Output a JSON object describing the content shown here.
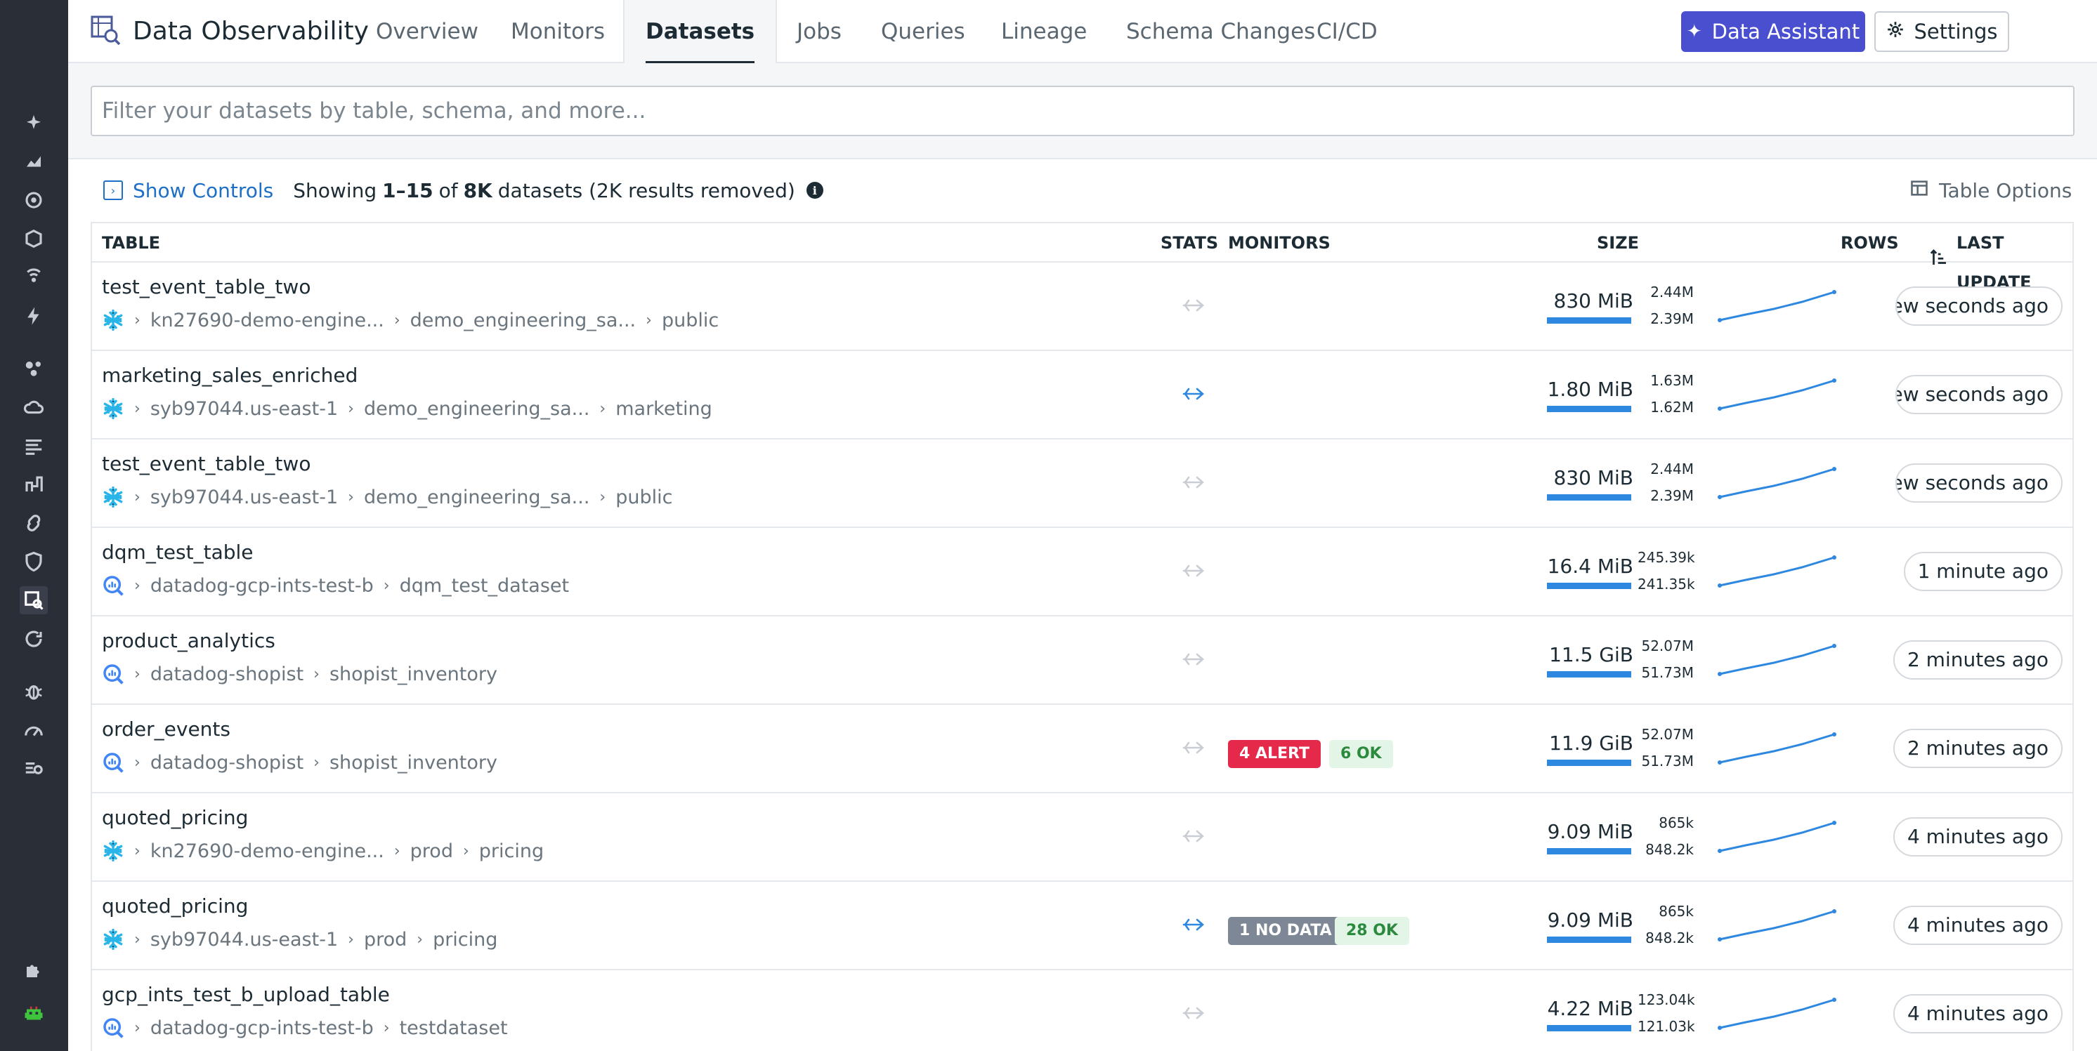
{
  "app": {
    "title": "Data Observability"
  },
  "nav": {
    "tabs": [
      {
        "label": "Overview"
      },
      {
        "label": "Monitors"
      },
      {
        "label": "Datasets"
      },
      {
        "label": "Jobs"
      },
      {
        "label": "Queries"
      },
      {
        "label": "Lineage"
      },
      {
        "label": "Schema Changes"
      },
      {
        "label": "CI/CD"
      }
    ],
    "active_tab": "Datasets",
    "assistant_label": "Data Assistant",
    "settings_label": "Settings"
  },
  "filter": {
    "placeholder": "Filter your datasets by table, schema, and more...",
    "value": ""
  },
  "controls": {
    "show_controls_label": "Show Controls",
    "summary_prefix": "Showing",
    "summary_range": "1–15",
    "summary_of": "of",
    "summary_total": "8K",
    "summary_suffix": "datasets (2K results removed)",
    "table_options_label": "Table Options"
  },
  "table": {
    "columns": {
      "table": "TABLE",
      "stats": "STATS",
      "monitors": "MONITORS",
      "size": "SIZE",
      "rows": "ROWS",
      "last_update": "LAST UPDATE"
    },
    "rows": [
      {
        "name": "test_event_table_two",
        "source": "snowflake",
        "path": [
          "kn27690-demo-engine...",
          "demo_engineering_sa...",
          "public"
        ],
        "stats": "inactive",
        "monitors": [],
        "size": "830 MiB",
        "rows_hi": "2.44M",
        "rows_lo": "2.39M",
        "last_update": "a few seconds ago"
      },
      {
        "name": "marketing_sales_enriched",
        "source": "snowflake",
        "path": [
          "syb97044.us-east-1",
          "demo_engineering_sa...",
          "marketing"
        ],
        "stats": "active",
        "monitors": [],
        "size": "1.80 MiB",
        "rows_hi": "1.63M",
        "rows_lo": "1.62M",
        "last_update": "a few seconds ago"
      },
      {
        "name": "test_event_table_two",
        "source": "snowflake",
        "path": [
          "syb97044.us-east-1",
          "demo_engineering_sa...",
          "public"
        ],
        "stats": "inactive",
        "monitors": [],
        "size": "830 MiB",
        "rows_hi": "2.44M",
        "rows_lo": "2.39M",
        "last_update": "a few seconds ago"
      },
      {
        "name": "dqm_test_table",
        "source": "bigquery",
        "path": [
          "datadog-gcp-ints-test-b",
          "dqm_test_dataset"
        ],
        "stats": "inactive",
        "monitors": [],
        "size": "16.4 MiB",
        "rows_hi": "245.39k",
        "rows_lo": "241.35k",
        "last_update": "1 minute ago"
      },
      {
        "name": "product_analytics",
        "source": "bigquery",
        "path": [
          "datadog-shopist",
          "shopist_inventory"
        ],
        "stats": "inactive",
        "monitors": [],
        "size": "11.5 GiB",
        "rows_hi": "52.07M",
        "rows_lo": "51.73M",
        "last_update": "2 minutes ago"
      },
      {
        "name": "order_events",
        "source": "bigquery",
        "path": [
          "datadog-shopist",
          "shopist_inventory"
        ],
        "stats": "inactive",
        "monitors": [
          {
            "kind": "alert",
            "label": "4 ALERT"
          },
          {
            "kind": "ok",
            "label": "6 OK"
          }
        ],
        "size": "11.9 GiB",
        "rows_hi": "52.07M",
        "rows_lo": "51.73M",
        "last_update": "2 minutes ago"
      },
      {
        "name": "quoted_pricing",
        "source": "snowflake",
        "path": [
          "kn27690-demo-engine...",
          "prod",
          "pricing"
        ],
        "stats": "inactive",
        "monitors": [],
        "size": "9.09 MiB",
        "rows_hi": "865k",
        "rows_lo": "848.2k",
        "last_update": "4 minutes ago"
      },
      {
        "name": "quoted_pricing",
        "source": "snowflake",
        "path": [
          "syb97044.us-east-1",
          "prod",
          "pricing"
        ],
        "stats": "active",
        "monitors": [
          {
            "kind": "nodata",
            "label": "1 NO DATA"
          },
          {
            "kind": "ok",
            "label": "28 OK"
          }
        ],
        "size": "9.09 MiB",
        "rows_hi": "865k",
        "rows_lo": "848.2k",
        "last_update": "4 minutes ago"
      },
      {
        "name": "gcp_ints_test_b_upload_table",
        "source": "bigquery",
        "path": [
          "datadog-gcp-ints-test-b",
          "testdataset"
        ],
        "stats": "inactive",
        "monitors": [],
        "size": "4.22 MiB",
        "rows_hi": "123.04k",
        "rows_lo": "121.03k",
        "last_update": "4 minutes ago"
      }
    ]
  },
  "colors": {
    "accent": "#4a4fcf",
    "link": "#1e6fc7",
    "sidebar": "#2a2e37",
    "bar": "#2f88e0",
    "alert": "#e5294a",
    "ok": "#2b8a3e",
    "nodata": "#7d8796"
  }
}
